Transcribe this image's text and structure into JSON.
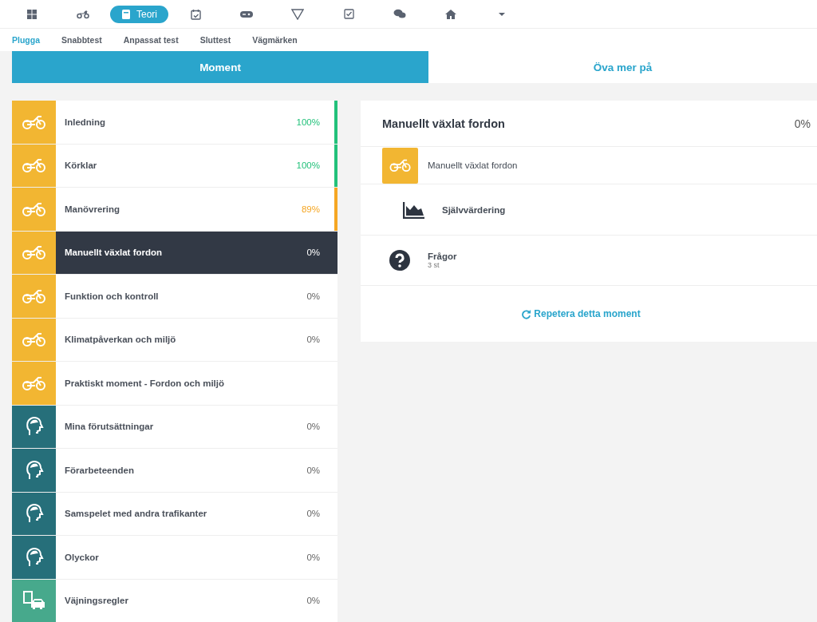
{
  "top_nav": [
    {
      "selected": false
    },
    {
      "selected": false
    },
    {
      "label": "Teori",
      "selected": true
    },
    {
      "selected": false
    },
    {
      "selected": false
    },
    {
      "selected": false
    },
    {
      "selected": false
    },
    {
      "selected": false
    },
    {
      "selected": false
    },
    {
      "selected": false
    }
  ],
  "sub_tabs": [
    {
      "label": "Plugga",
      "selected": true
    },
    {
      "label": "Snabbtest",
      "selected": false
    },
    {
      "label": "Anpassat test",
      "selected": false
    },
    {
      "label": "Sluttest",
      "selected": false
    },
    {
      "label": "Vägmärken",
      "selected": false
    }
  ],
  "segments": [
    {
      "label": "Moment",
      "selected": true
    },
    {
      "label": "Öva mer på",
      "selected": false
    }
  ],
  "moments": [
    {
      "kind": "vehicle",
      "label": "Inledning",
      "percent": "100%",
      "color": "#22c17a",
      "selected": false
    },
    {
      "kind": "vehicle",
      "label": "Körklar",
      "percent": "100%",
      "color": "#22c17a",
      "selected": false
    },
    {
      "kind": "vehicle",
      "label": "Manövrering",
      "percent": "89%",
      "color": "#f5a623",
      "selected": false
    },
    {
      "kind": "vehicle",
      "label": "Manuellt växlat fordon",
      "percent": "0%",
      "selected": true
    },
    {
      "kind": "vehicle",
      "label": "Funktion och kontroll",
      "percent": "0%",
      "selected": false
    },
    {
      "kind": "vehicle",
      "label": "Klimatpåverkan och miljö",
      "percent": "0%",
      "selected": false
    },
    {
      "kind": "vehicle",
      "label": "Praktiskt moment - Fordon och miljö",
      "selected": false
    },
    {
      "kind": "person",
      "label": "Mina förutsättningar",
      "percent": "0%",
      "selected": false
    },
    {
      "kind": "person",
      "label": "Förarbeteenden",
      "percent": "0%",
      "selected": false
    },
    {
      "kind": "person",
      "label": "Samspelet med andra trafikanter",
      "percent": "0%",
      "selected": false
    },
    {
      "kind": "person",
      "label": "Olyckor",
      "percent": "0%",
      "selected": false
    },
    {
      "kind": "traffic",
      "label": "Väjningsregler",
      "percent": "0%",
      "selected": false
    }
  ],
  "detail": {
    "title": "Manuellt växlat fordon",
    "percent": "0%",
    "items": [
      {
        "kind": "vehicle",
        "label": "Manuellt växlat fordon"
      },
      {
        "kind": "chart",
        "label": "Självvärdering"
      },
      {
        "kind": "question",
        "label": "Frågor",
        "sub": "3 st"
      }
    ],
    "repeat_link": "Repetera detta moment"
  }
}
